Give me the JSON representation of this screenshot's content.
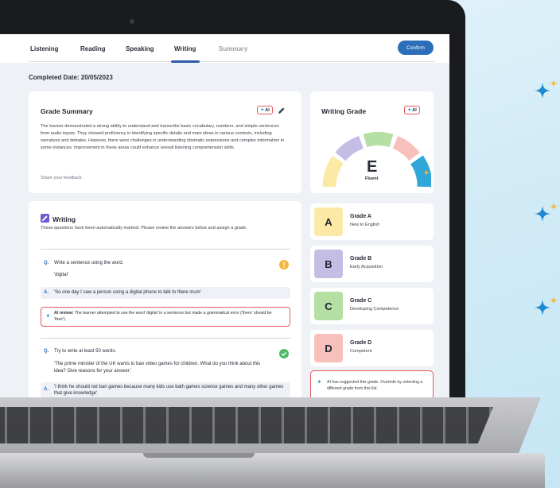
{
  "tabs": {
    "listening": "Listening",
    "reading": "Reading",
    "speaking": "Speaking",
    "writing": "Writing",
    "summary": "Summary"
  },
  "confirm_label": "Confirm",
  "completed_date": "Completed Date: 20/05/2023",
  "ai_chip": "AI",
  "grade_summary": {
    "title": "Grade Summary",
    "text": "The learner demonstrated a strong ability to understand and transcribe basic vocabulary, numbers, and simple sentences from audio inputs. They showed proficiency in identifying specific details and main ideas in various contexts, including narratives and debates. However, there were challenges in understanding idiomatic expressions and complex information in some instances. Improvement in these areas could enhance overall listening comprehension skills.",
    "feedback": "Share your feedback"
  },
  "writing_grade": {
    "title": "Writing Grade",
    "letter": "E",
    "word": "Fluent"
  },
  "writing": {
    "title": "Writing",
    "intro": "These questions have been automatically marked. Please review the answers below and assign a grade.",
    "q1": {
      "q_label": "Q.",
      "question": "Write a sentence using the word.",
      "word": "'digital'",
      "a_label": "A.",
      "answer": "'So one day I saw a person using a digital phone to talk to there mum'",
      "review_label": "AI review:",
      "review_text": "The learner attempted to use the word 'digital' in a sentence but made a grammatical error ('there' should be 'their')."
    },
    "q2": {
      "q_label": "Q.",
      "question": "Try to write at least 50 words.",
      "prompt": "'The prime minister of the UK wants to ban video games for children. What do you think about this idea? Give reasons for your answer.'",
      "a_label": "A.",
      "answer": "'I think he should not ban games because many kids use bath games science games and many other games that give knowledge'"
    }
  },
  "grades": [
    {
      "letter": "A",
      "name": "Grade A",
      "desc": "New to English",
      "color": "#fde9a6"
    },
    {
      "letter": "B",
      "name": "Grade B",
      "desc": "Early Acquisition",
      "color": "#c4bde4"
    },
    {
      "letter": "C",
      "name": "Grade C",
      "desc": "Developing Competence",
      "color": "#b6dfa3"
    },
    {
      "letter": "D",
      "name": "Grade D",
      "desc": "Competent",
      "color": "#f8c0bb"
    }
  ],
  "grade_note": "AI has suggested this grade. Override by selecting a different grade from this list.",
  "colors": {
    "accent": "#2a6fb8",
    "warning": "#f4b63a",
    "success": "#4fb86a",
    "ai_border": "#e1595f"
  }
}
